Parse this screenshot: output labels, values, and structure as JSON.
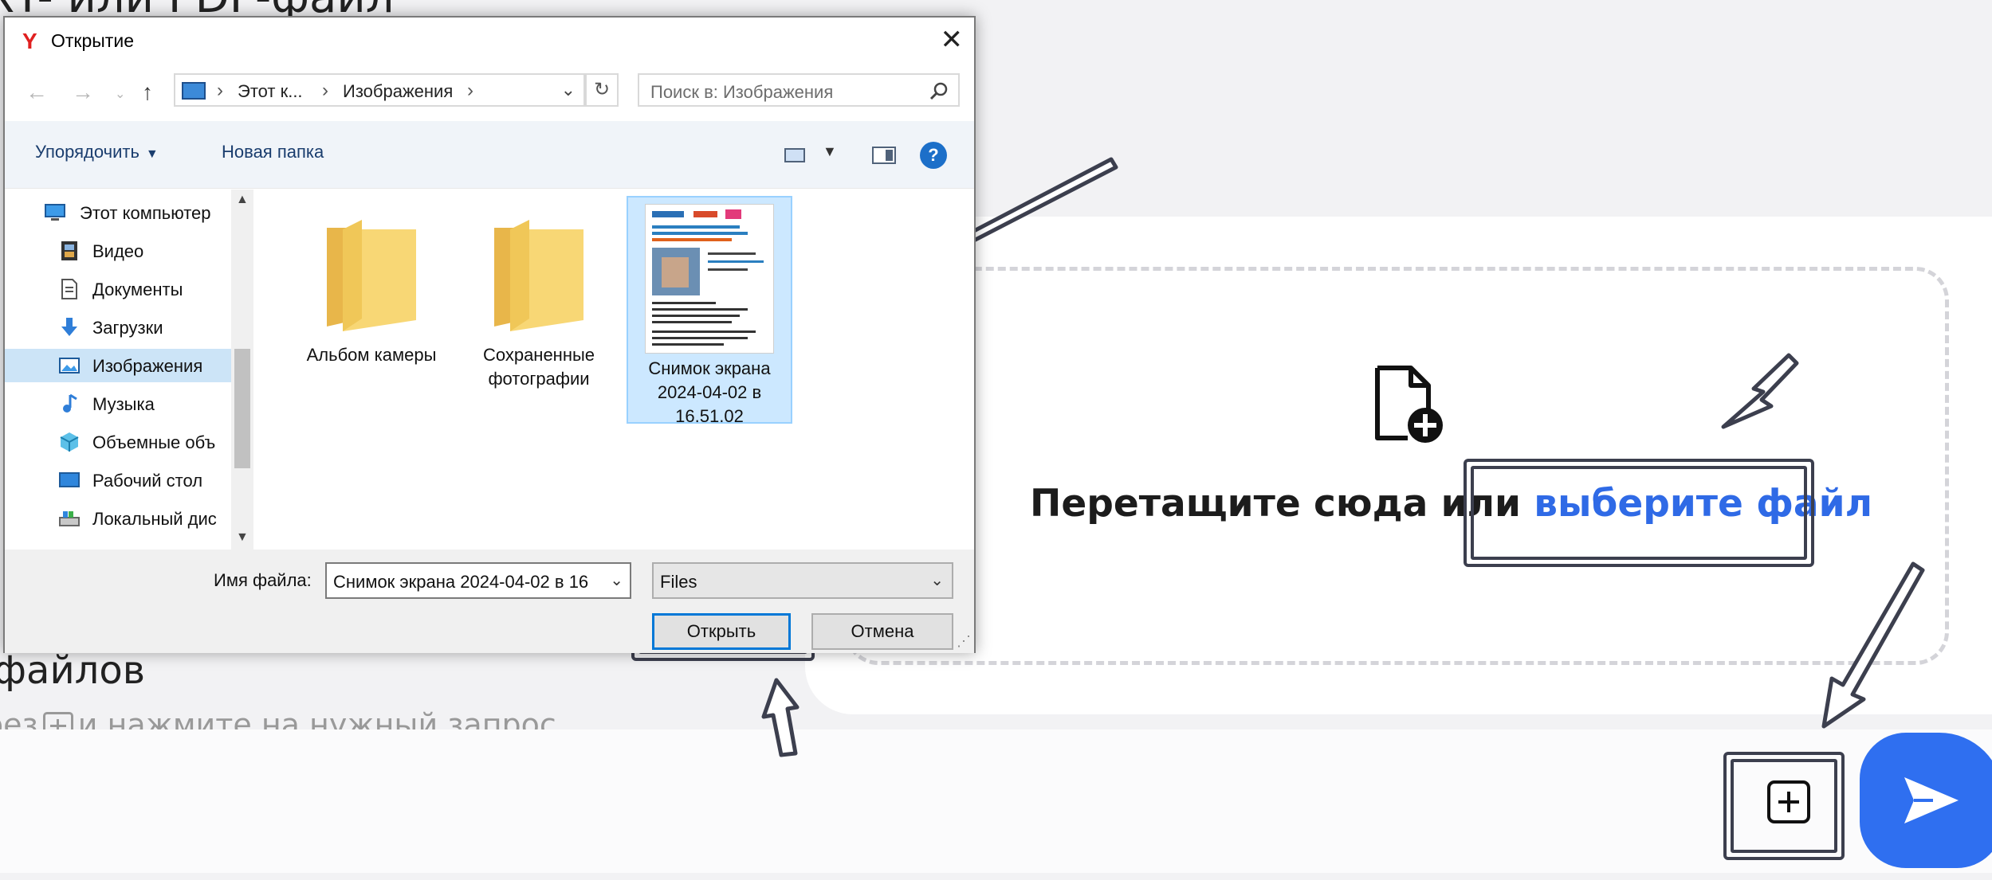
{
  "background": {
    "heading_top": "XT- или PDF-файл",
    "heading_bottom": "файлов",
    "sub_before": "рез",
    "sub_after": "и нажмите на нужный запрос",
    "drop_text": "Перетащите сюда или ",
    "drop_link": "выберите файл",
    "accent_color": "#2f6ae6"
  },
  "dialog": {
    "title": "Открытие",
    "address": {
      "segment1": "Этот к...",
      "segment2": "Изображения"
    },
    "search_placeholder": "Поиск в: Изображения",
    "toolbar": {
      "organize": "Упорядочить",
      "new_folder": "Новая папка"
    },
    "nav_items": [
      {
        "label": "Этот компьютер",
        "icon": "computer-icon"
      },
      {
        "label": "Видео",
        "icon": "video-icon"
      },
      {
        "label": "Документы",
        "icon": "documents-icon"
      },
      {
        "label": "Загрузки",
        "icon": "downloads-icon"
      },
      {
        "label": "Изображения",
        "icon": "pictures-icon",
        "selected": true
      },
      {
        "label": "Музыка",
        "icon": "music-icon"
      },
      {
        "label": "Объемные объ",
        "icon": "3d-objects-icon"
      },
      {
        "label": "Рабочий стол",
        "icon": "desktop-icon"
      },
      {
        "label": "Локальный дис",
        "icon": "disk-icon"
      }
    ],
    "files": [
      {
        "name_line1": "Альбом камеры",
        "name_line2": "",
        "name_line3": "",
        "type": "folder"
      },
      {
        "name_line1": "Сохраненные",
        "name_line2": "фотографии",
        "name_line3": "",
        "type": "folder"
      },
      {
        "name_line1": "Снимок экрана",
        "name_line2": "2024-04-02 в",
        "name_line3": "16.51.02",
        "type": "image",
        "selected": true
      }
    ],
    "file_name_label": "Имя файла:",
    "file_name_value": "Снимок экрана 2024-04-02 в 16",
    "file_type": "Files",
    "open_button": "Открыть",
    "cancel_button": "Отмена"
  }
}
